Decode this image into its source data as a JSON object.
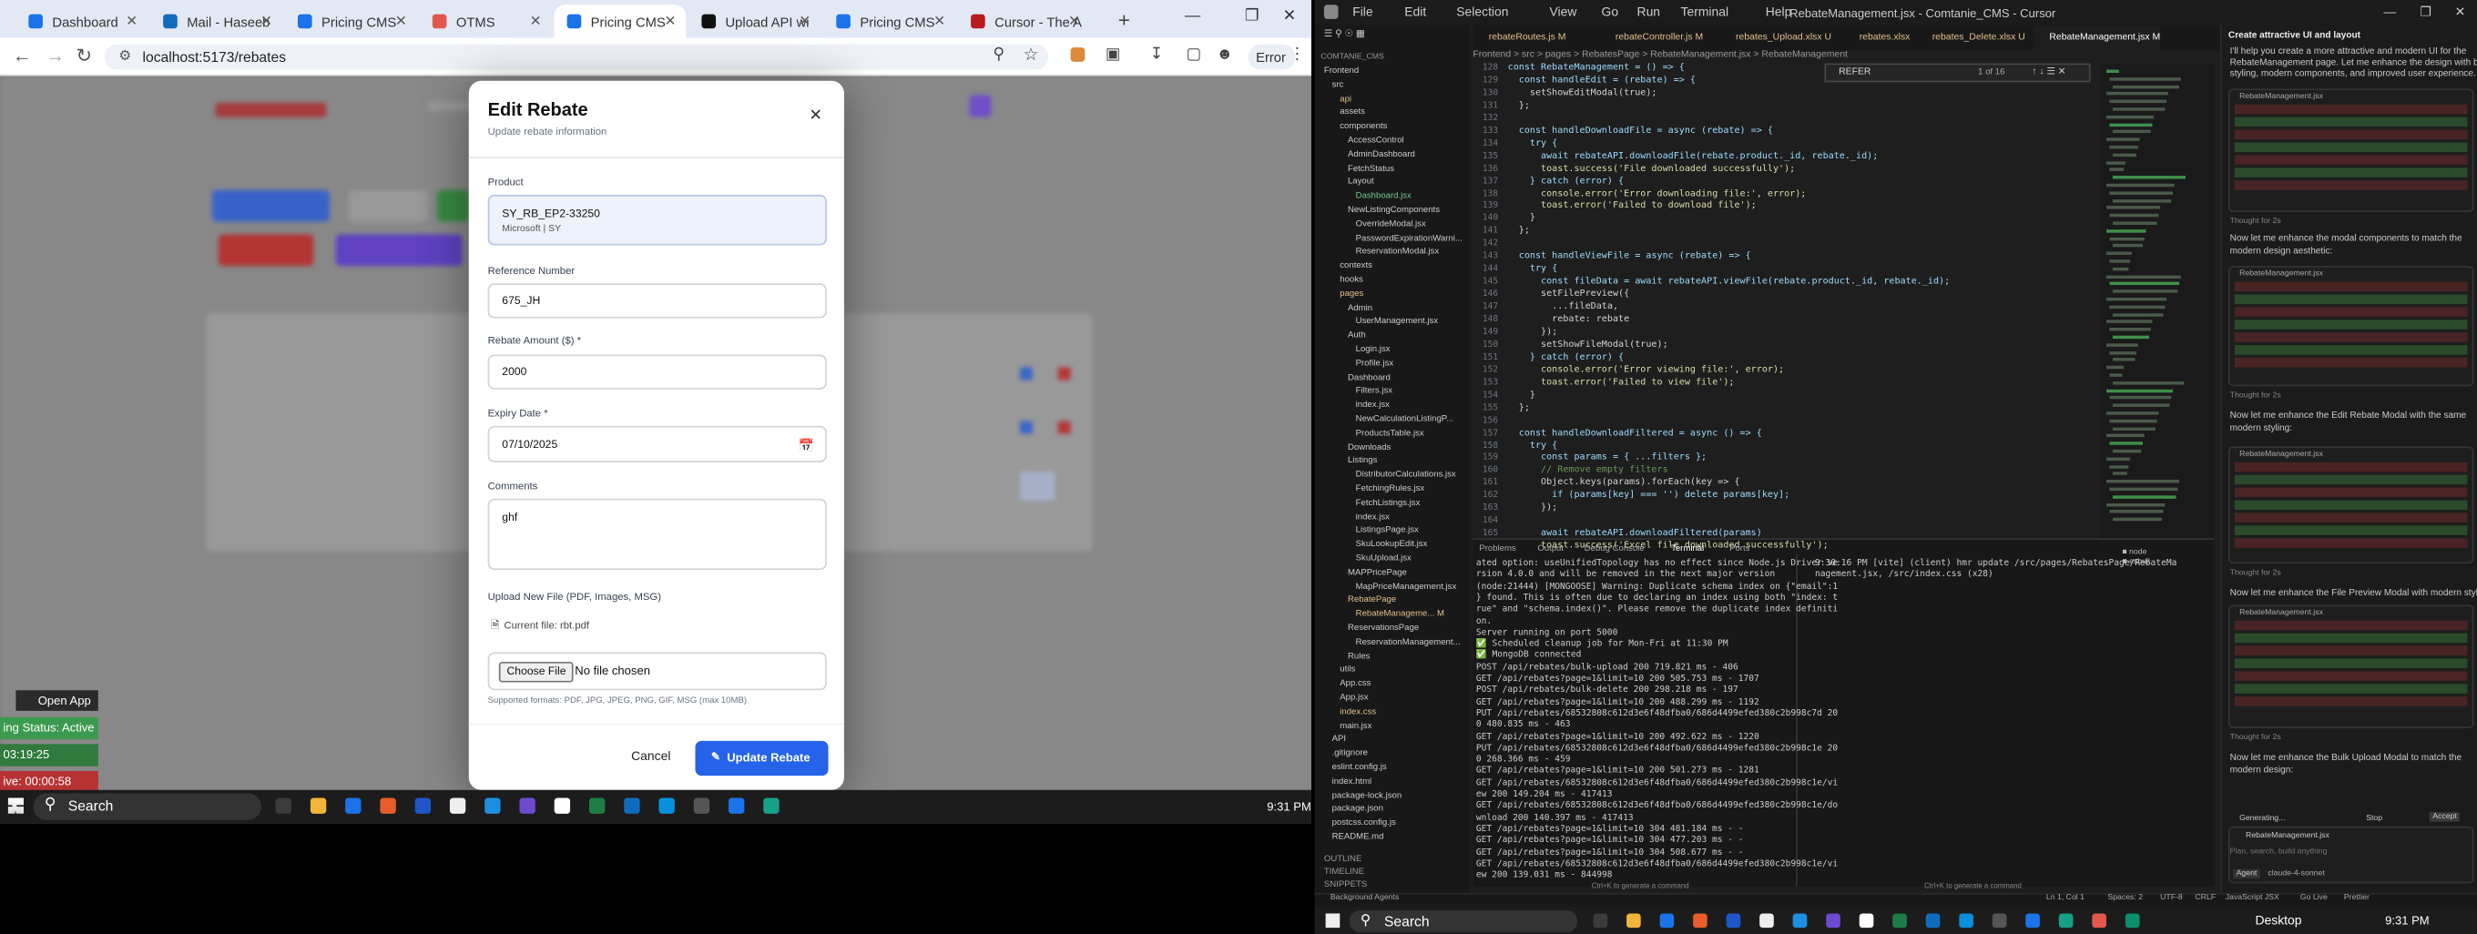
{
  "browser": {
    "tabs": [
      {
        "title": "Dashboard",
        "color": "#1a73e8"
      },
      {
        "title": "Mail - Haseeb",
        "color": "#0f6cbd"
      },
      {
        "title": "Pricing CMS",
        "color": "#1a73e8"
      },
      {
        "title": "OTMS",
        "color": "#e2574c"
      },
      {
        "title": "Pricing CMS",
        "color": "#1a73e8"
      },
      {
        "title": "Upload API wi",
        "color": "#111111"
      },
      {
        "title": "Pricing CMS",
        "color": "#1a73e8"
      },
      {
        "title": "Cursor - The A",
        "color": "#b91c1c"
      }
    ],
    "url": "localhost:5173/rebates",
    "error_label": "Error"
  },
  "modal": {
    "title": "Edit Rebate",
    "subtitle": "Update rebate information",
    "product_label": "Product",
    "product_name": "SY_RB_EP2-33250",
    "product_sub": "Microsoft | SY",
    "ref_label": "Reference Number",
    "ref_value": "675_JH",
    "amount_label": "Rebate Amount ($) *",
    "amount_value": "2000",
    "expiry_label": "Expiry Date *",
    "expiry_value": "07/10/2025",
    "comments_label": "Comments",
    "comments_value": "ghf",
    "upload_label": "Upload New File (PDF, Images, MSG)",
    "current_file": "Current file: rbt.pdf",
    "choose_file": "Choose File",
    "no_file": "No file chosen",
    "supported": "Supported formats: PDF, JPG, JPEG, PNG, GIF, MSG (max 10MB)",
    "cancel": "Cancel",
    "update": "Update Rebate"
  },
  "page_bg": {
    "open_app": "Open App",
    "status_active": "ing Status: Active",
    "time1": "03:19:25",
    "time2": "ive: 00:00:58"
  },
  "taskbar": {
    "search": "Search",
    "time": "9:31 PM",
    "desktop": "Desktop"
  },
  "cursor": {
    "window_title": "RebateManagement.jsx - Comtanie_CMS - Cursor",
    "menus": [
      "File",
      "Edit",
      "Selection",
      "View",
      "Go",
      "Run",
      "Terminal",
      "Help"
    ],
    "editor_tabs": [
      "rebateRoutes.js M",
      "rebateController.js M",
      "rebates_Upload.xlsx U",
      "rebates.xlsx",
      "rebates_Delete.xlsx U",
      "RebateManagement.jsx M"
    ],
    "breadcrumb": "Frontend > src > pages > RebatesPage > RebateManagement.jsx > RebateManagement",
    "find_text": "REFER",
    "find_count": "1 of 16",
    "line_numbers": [
      "128",
      "129",
      "130",
      "131",
      "132",
      "133",
      "134",
      "135",
      "136",
      "137",
      "138",
      "139",
      "140",
      "141",
      "142",
      "143",
      "144",
      "145",
      "146",
      "147",
      "148",
      "149",
      "150",
      "151",
      "152",
      "153",
      "154",
      "155",
      "156",
      "157",
      "158",
      "159",
      "160",
      "161",
      "162",
      "163",
      "164",
      "165"
    ],
    "code": [
      "const RebateManagement = () => {",
      "  const handleEdit = (rebate) => {",
      "    setShowEditModal(true);",
      "  };",
      "",
      "  const handleDownloadFile = async (rebate) => {",
      "    try {",
      "      await rebateAPI.downloadFile(rebate.product._id, rebate._id);",
      "      toast.success('File downloaded successfully');",
      "    } catch (error) {",
      "      console.error('Error downloading file:', error);",
      "      toast.error('Failed to download file');",
      "    }",
      "  };",
      "",
      "  const handleViewFile = async (rebate) => {",
      "    try {",
      "      const fileData = await rebateAPI.viewFile(rebate.product._id, rebate._id);",
      "      setFilePreview({",
      "        ...fileData,",
      "        rebate: rebate",
      "      });",
      "      setShowFileModal(true);",
      "    } catch (error) {",
      "      console.error('Error viewing file:', error);",
      "      toast.error('Failed to view file');",
      "    }",
      "  };",
      "",
      "  const handleDownloadFiltered = async () => {",
      "    try {",
      "      const params = { ...filters };",
      "      // Remove empty filters",
      "      Object.keys(params).forEach(key => {",
      "        if (params[key] === '') delete params[key];",
      "      });",
      "",
      "      await rebateAPI.downloadFiltered(params)",
      "      toast.success('Excel file downloaded successfully');"
    ],
    "panel_tabs": [
      "Problems",
      "Output",
      "Debug Console",
      "Terminal",
      "Ports"
    ],
    "terminal_left": [
      "ated option: useUnifiedTopology has no effect since Node.js Driver ve",
      "rsion 4.0.0 and will be removed in the next major version",
      "(node:21444) [MONGOOSE] Warning: Duplicate schema index on {\"email\":1",
      "} found. This is often due to declaring an index using both \"index: t",
      "rue\" and \"schema.index()\". Please remove the duplicate index definiti",
      "on.",
      "Server running on port 5000",
      "✅ Scheduled cleanup job for Mon-Fri at 11:30 PM",
      "✅ MongoDB connected",
      "POST /api/rebates/bulk-upload 200 719.821 ms - 406",
      "GET /api/rebates?page=1&limit=10 200 505.753 ms - 1707",
      "POST /api/rebates/bulk-delete 200 298.218 ms - 197",
      "GET /api/rebates?page=1&limit=10 200 488.299 ms - 1192",
      "PUT /api/rebates/68532808c612d3e6f48dfba0/686d4499efed380c2b998c7d 20",
      "0 480.835 ms - 463",
      "GET /api/rebates?page=1&limit=10 200 492.622 ms - 1220",
      "PUT /api/rebates/68532808c612d3e6f48dfba0/686d4499efed380c2b998c1e 20",
      "0 268.366 ms - 459",
      "GET /api/rebates?page=1&limit=10 200 501.273 ms - 1281",
      "GET /api/rebates/68532808c612d3e6f48dfba0/686d4499efed380c2b998c1e/vi",
      "ew 200 149.204 ms - 417413",
      "GET /api/rebates/68532808c612d3e6f48dfba0/686d4499efed380c2b998c1e/do",
      "wnload 200 140.397 ms - 417413",
      "GET /api/rebates?page=1&limit=10 304 481.184 ms - -",
      "GET /api/rebates?page=1&limit=10 304 477.203 ms - -",
      "GET /api/rebates?page=1&limit=10 304 508.677 ms - -",
      "GET /api/rebates/68532808c612d3e6f48dfba0/686d4499efed380c2b998c1e/vi",
      "ew 200 139.031 ms - 844998"
    ],
    "terminal_right": [
      "9:30:16 PM [vite] (client) hmr update /src/pages/RebatesPage/RebateMa",
      "nagement.jsx, /src/index.css (x28)"
    ],
    "explorer": [
      {
        "t": "Frontend",
        "d": 0,
        "c": "#ccc"
      },
      {
        "t": "src",
        "d": 1,
        "c": "#ccc"
      },
      {
        "t": "api",
        "d": 2,
        "c": "#e2c08d"
      },
      {
        "t": "assets",
        "d": 2,
        "c": "#ccc"
      },
      {
        "t": "components",
        "d": 2,
        "c": "#ccc"
      },
      {
        "t": "AccessControl",
        "d": 3,
        "c": "#ccc"
      },
      {
        "t": "AdminDashboard",
        "d": 3,
        "c": "#ccc"
      },
      {
        "t": "FetchStatus",
        "d": 3,
        "c": "#ccc"
      },
      {
        "t": "Layout",
        "d": 3,
        "c": "#ccc"
      },
      {
        "t": "Dashboard.jsx",
        "d": 4,
        "c": "#73c991"
      },
      {
        "t": "NewListingComponents",
        "d": 3,
        "c": "#ccc"
      },
      {
        "t": "OverrideModal.jsx",
        "d": 4,
        "c": "#ccc"
      },
      {
        "t": "PasswordExpirationWarni...",
        "d": 4,
        "c": "#ccc"
      },
      {
        "t": "ReservationModal.jsx",
        "d": 4,
        "c": "#ccc"
      },
      {
        "t": "contexts",
        "d": 2,
        "c": "#ccc"
      },
      {
        "t": "hooks",
        "d": 2,
        "c": "#ccc"
      },
      {
        "t": "pages",
        "d": 2,
        "c": "#e2c08d"
      },
      {
        "t": "Admin",
        "d": 3,
        "c": "#ccc"
      },
      {
        "t": "UserManagement.jsx",
        "d": 4,
        "c": "#ccc"
      },
      {
        "t": "Auth",
        "d": 3,
        "c": "#ccc"
      },
      {
        "t": "Login.jsx",
        "d": 4,
        "c": "#ccc"
      },
      {
        "t": "Profile.jsx",
        "d": 4,
        "c": "#ccc"
      },
      {
        "t": "Dashboard",
        "d": 3,
        "c": "#ccc"
      },
      {
        "t": "Filters.jsx",
        "d": 4,
        "c": "#ccc"
      },
      {
        "t": "index.jsx",
        "d": 4,
        "c": "#ccc"
      },
      {
        "t": "NewCalculationListingP...",
        "d": 4,
        "c": "#ccc"
      },
      {
        "t": "ProductsTable.jsx",
        "d": 4,
        "c": "#ccc"
      },
      {
        "t": "Downloads",
        "d": 3,
        "c": "#ccc"
      },
      {
        "t": "Listings",
        "d": 3,
        "c": "#ccc"
      },
      {
        "t": "DistributorCalculations.jsx",
        "d": 4,
        "c": "#ccc"
      },
      {
        "t": "FetchingRules.jsx",
        "d": 4,
        "c": "#ccc"
      },
      {
        "t": "FetchListings.jsx",
        "d": 4,
        "c": "#ccc"
      },
      {
        "t": "index.jsx",
        "d": 4,
        "c": "#ccc"
      },
      {
        "t": "ListingsPage.jsx",
        "d": 4,
        "c": "#ccc"
      },
      {
        "t": "SkuLookupEdit.jsx",
        "d": 4,
        "c": "#ccc"
      },
      {
        "t": "SkuUpload.jsx",
        "d": 4,
        "c": "#ccc"
      },
      {
        "t": "MAPPricePage",
        "d": 3,
        "c": "#ccc"
      },
      {
        "t": "MapPriceManagement.jsx",
        "d": 4,
        "c": "#ccc"
      },
      {
        "t": "RebatePage",
        "d": 3,
        "c": "#e2c08d"
      },
      {
        "t": "RebateManageme... M",
        "d": 4,
        "c": "#e2c08d"
      },
      {
        "t": "ReservationsPage",
        "d": 3,
        "c": "#ccc"
      },
      {
        "t": "ReservationManagement...",
        "d": 4,
        "c": "#ccc"
      },
      {
        "t": "Rules",
        "d": 3,
        "c": "#ccc"
      },
      {
        "t": "utils",
        "d": 2,
        "c": "#ccc"
      },
      {
        "t": "App.css",
        "d": 2,
        "c": "#ccc"
      },
      {
        "t": "App.jsx",
        "d": 2,
        "c": "#ccc"
      },
      {
        "t": "index.css",
        "d": 2,
        "c": "#e2c08d"
      },
      {
        "t": "main.jsx",
        "d": 2,
        "c": "#ccc"
      },
      {
        "t": "API",
        "d": 1,
        "c": "#ccc"
      },
      {
        "t": ".gitignore",
        "d": 1,
        "c": "#ccc"
      },
      {
        "t": "eslint.config.js",
        "d": 1,
        "c": "#ccc"
      },
      {
        "t": "index.html",
        "d": 1,
        "c": "#ccc"
      },
      {
        "t": "package-lock.json",
        "d": 1,
        "c": "#ccc"
      },
      {
        "t": "package.json",
        "d": 1,
        "c": "#ccc"
      },
      {
        "t": "postcss.config.js",
        "d": 1,
        "c": "#ccc"
      },
      {
        "t": "README.md",
        "d": 1,
        "c": "#ccc"
      }
    ],
    "outline": [
      "OUTLINE",
      "TIMELINE",
      "SNIPPETS"
    ],
    "chat_title": "Create attractive UI and layout",
    "chat_intro": [
      "I'll help you create a more attractive and modern UI for the",
      "RebateManagement page. Let me enhance the design with better",
      "styling, modern components, and improved user experience."
    ],
    "chat_msgs": [
      "Now let me enhance the modal components to match the",
      "modern design aesthetic:",
      "Now let me enhance the Edit Rebate Modal with the same",
      "modern styling:",
      "Now let me enhance the File Preview Modal with modern styling:",
      "Now let me enhance the Bulk Upload Modal to match the",
      "modern design:"
    ],
    "thought": "Thought for 2s",
    "file_chip": "RebateManagement.jsx",
    "generating": "Generating...",
    "stop": "Stop",
    "accept": "Accept",
    "chat_placeholder": "Plan, search, build anything",
    "agent": "Agent",
    "model": "claude-4-sonnet",
    "status_items": [
      "Background Agents",
      "Ln 1, Col 1",
      "Spaces: 2",
      "UTF-8",
      "CRLF",
      "JavaScript JSX",
      "Go Live",
      "Prettier"
    ],
    "ctrl_hint": "Ctrl+K to generate a command"
  }
}
